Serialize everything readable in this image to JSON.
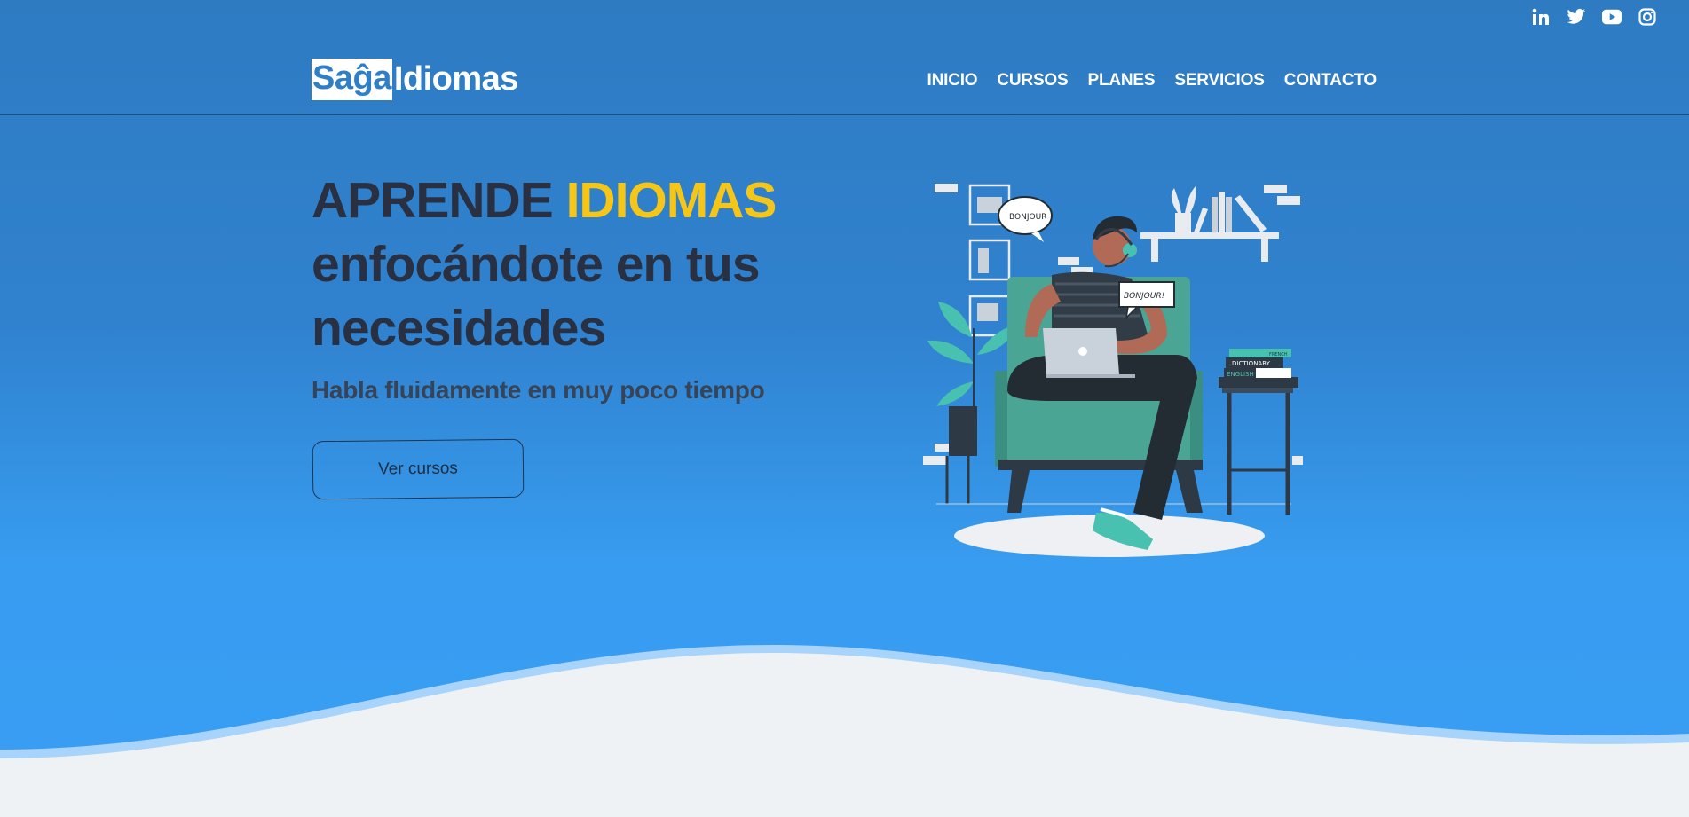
{
  "social": {
    "icons": [
      "linkedin-icon",
      "twitter-icon",
      "youtube-icon",
      "instagram-icon"
    ]
  },
  "brand": {
    "logo_part1": "Saĝa",
    "logo_part2": "Idiomas"
  },
  "nav": {
    "items": [
      "INICIO",
      "CURSOS",
      "PLANES",
      "SERVICIOS",
      "CONTACTO"
    ]
  },
  "hero": {
    "title_word1": "APRENDE",
    "title_word2": "IDIOMAS",
    "title_line2": "enfocándote en tus",
    "title_line3": "necesidades",
    "subtitle": "Habla fluidamente en muy poco tiempo",
    "cta_label": "Ver cursos"
  },
  "illustration": {
    "bubble1": "BONJOUR",
    "bubble2": "BONJOUR!",
    "book1": "DICTIONARY",
    "book2": "ENGLISH",
    "book3": "FRENCH"
  },
  "colors": {
    "accent": "#f5c517",
    "heading": "#283041",
    "bg_top": "#2e7bc2",
    "bg_bottom": "#399ef4",
    "section_bg": "#eff2f5"
  }
}
